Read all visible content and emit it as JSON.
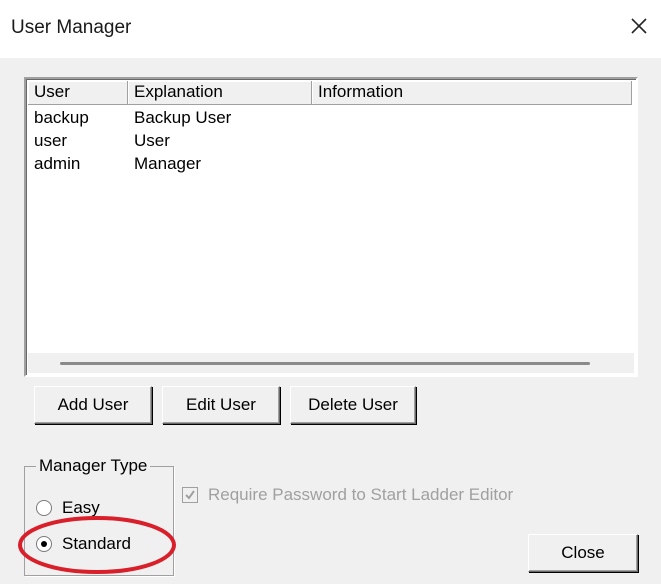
{
  "window": {
    "title": "User Manager"
  },
  "icons": {
    "close": "close-icon",
    "check": "checkmark-icon"
  },
  "list": {
    "columns": [
      "User",
      "Explanation",
      "Information"
    ],
    "rows": [
      {
        "user": "backup",
        "explanation": "Backup User",
        "information": ""
      },
      {
        "user": "user",
        "explanation": "User",
        "information": ""
      },
      {
        "user": "admin",
        "explanation": "Manager",
        "information": ""
      }
    ]
  },
  "buttons": {
    "add_user": "Add User",
    "edit_user": "Edit User",
    "delete_user": "Delete User",
    "close": "Close"
  },
  "manager_type": {
    "label": "Manager Type",
    "options": [
      "Easy",
      "Standard"
    ],
    "selected": "Standard"
  },
  "require_password": {
    "label": "Require Password to Start Ladder Editor",
    "checked": true,
    "enabled": false
  },
  "colors": {
    "highlight_circle": "#d91f2a",
    "disabled_text": "#a0a0a0",
    "window_bg": "#f0f0f0"
  }
}
